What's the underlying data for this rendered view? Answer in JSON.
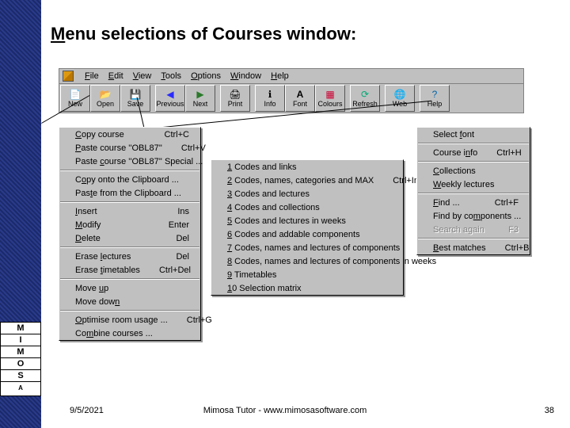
{
  "title_html": "<u>M</u>enu selections of Courses window:",
  "menubar": [
    "File",
    "Edit",
    "View",
    "Tools",
    "Options",
    "Window",
    "Help"
  ],
  "toolbar": [
    {
      "label": "New",
      "icon": "📄",
      "name": "new-button"
    },
    {
      "label": "Open",
      "icon": "📂",
      "name": "open-button"
    },
    {
      "label": "Save",
      "icon": "💾",
      "name": "save-button"
    },
    {
      "sep": true
    },
    {
      "label": "Previous",
      "icon": "◀",
      "name": "previous-button",
      "color": "#2a2aff"
    },
    {
      "label": "Next",
      "icon": "▶",
      "name": "next-button",
      "color": "#2a7a2a"
    },
    {
      "sep": true
    },
    {
      "label": "Print",
      "icon": "🖨",
      "name": "print-button"
    },
    {
      "sep": true
    },
    {
      "label": "Info",
      "icon": "ℹ",
      "name": "info-button"
    },
    {
      "label": "Font",
      "icon": "A",
      "name": "font-button",
      "bold": true
    },
    {
      "label": "Colours",
      "icon": "▦",
      "name": "colours-button",
      "color": "#cc0033"
    },
    {
      "sep": true
    },
    {
      "label": "Refresh",
      "icon": "⟳",
      "name": "refresh-button",
      "color": "#0a7"
    },
    {
      "sep": true
    },
    {
      "label": "Web",
      "icon": "🌐",
      "name": "web-button",
      "color": "#0a7"
    },
    {
      "sep": true
    },
    {
      "label": "Help",
      "icon": "?",
      "name": "help-button",
      "color": "#06a"
    }
  ],
  "edit_menu": [
    {
      "label": "Copy course",
      "u": 0,
      "shortcut": "Ctrl+C"
    },
    {
      "label": "Paste course ''OBL87''",
      "u": 0,
      "shortcut": "Ctrl+V"
    },
    {
      "label": "Paste course ''OBL87'' Special ...",
      "u": 6
    },
    {
      "sep": true
    },
    {
      "label": "Copy onto the Clipboard ...",
      "u": 1
    },
    {
      "label": "Paste from the Clipboard ...",
      "u": 3
    },
    {
      "sep": true
    },
    {
      "label": "Insert",
      "u": 0,
      "shortcut": "Ins"
    },
    {
      "label": "Modify",
      "u": 0,
      "shortcut": "Enter"
    },
    {
      "label": "Delete",
      "u": 0,
      "shortcut": "Del"
    },
    {
      "sep": true
    },
    {
      "label": "Erase lectures",
      "u": 6,
      "shortcut": "Del"
    },
    {
      "label": "Erase timetables",
      "u": 6,
      "shortcut": "Ctrl+Del"
    },
    {
      "sep": true
    },
    {
      "label": "Move up",
      "u": 5
    },
    {
      "label": "Move down",
      "u": 8
    },
    {
      "sep": true
    },
    {
      "label": "Optimise room usage ...",
      "u": 0,
      "shortcut": "Ctrl+G"
    },
    {
      "label": "Combine courses ...",
      "u": 2
    }
  ],
  "opt_menu": [
    {
      "label": "1 Codes and links",
      "u": 0
    },
    {
      "label": "2 Codes, names, categories and MAX",
      "u": 0,
      "shortcut": "Ctrl+Ins"
    },
    {
      "label": "3 Codes and lectures",
      "u": 0
    },
    {
      "label": "4 Codes and collections",
      "u": 0
    },
    {
      "label": "5 Codes and lectures in weeks",
      "u": 0
    },
    {
      "label": "6 Codes and addable components",
      "u": 0
    },
    {
      "label": "7 Codes, names and lectures of components",
      "u": 0
    },
    {
      "label": "8 Codes, names and lectures of components in weeks",
      "u": 0
    },
    {
      "label": "9 Timetables",
      "u": 0
    },
    {
      "label": "10 Selection matrix",
      "u": 0
    }
  ],
  "tools_menu": [
    {
      "label": "Select font",
      "u": 7
    },
    {
      "sep": true
    },
    {
      "label": "Course info",
      "u": 8,
      "shortcut": "Ctrl+H"
    },
    {
      "sep": true
    },
    {
      "label": "Collections",
      "u": 0
    },
    {
      "label": "Weekly lectures",
      "u": 0
    },
    {
      "sep": true
    },
    {
      "label": "Find ...",
      "u": 0,
      "shortcut": "Ctrl+F"
    },
    {
      "label": "Find by components ...",
      "u": 10
    },
    {
      "label": "Search again",
      "shortcut": "F3",
      "disabled": true
    },
    {
      "sep": true
    },
    {
      "label": "Best matches",
      "u": 0,
      "shortcut": "Ctrl+B"
    }
  ],
  "footer": {
    "date": "9/5/2021",
    "center": "Mimosa Tutor - www.mimosasoftware.com",
    "page": "38"
  },
  "logo": [
    "M",
    "I",
    "M",
    "O",
    "S",
    "A"
  ]
}
